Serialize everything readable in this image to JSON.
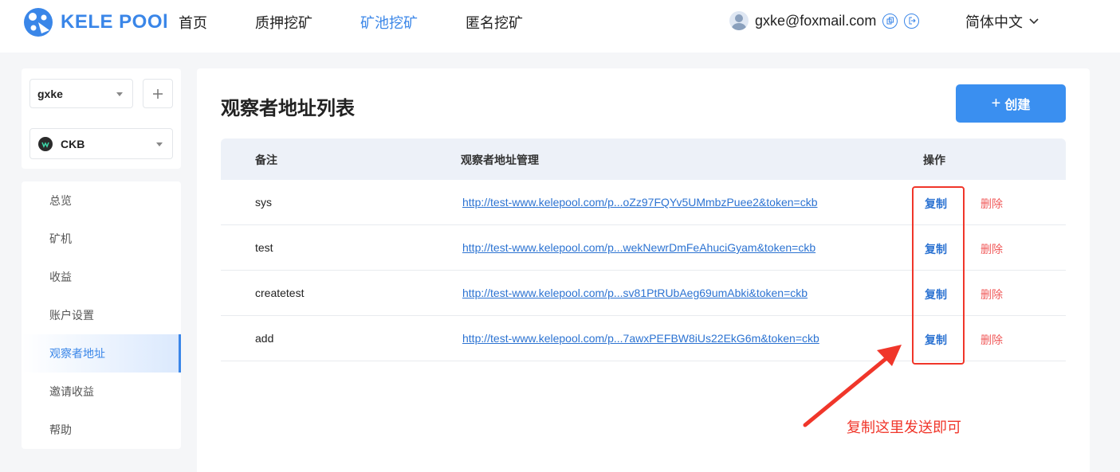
{
  "brand": {
    "name": "KELE POOl"
  },
  "nav": {
    "items": [
      {
        "label": "首页"
      },
      {
        "label": "质押挖矿"
      },
      {
        "label": "矿池挖矿"
      },
      {
        "label": "匿名挖矿"
      }
    ]
  },
  "user": {
    "email": "gxke@foxmail.com"
  },
  "language": {
    "label": "简体中文"
  },
  "sidebar": {
    "account_select": {
      "value": "gxke"
    },
    "coin_select": {
      "value": "CKB"
    },
    "menu": [
      {
        "label": "总览"
      },
      {
        "label": "矿机"
      },
      {
        "label": "收益"
      },
      {
        "label": "账户设置"
      },
      {
        "label": "观察者地址"
      },
      {
        "label": "邀请收益"
      },
      {
        "label": "帮助"
      }
    ]
  },
  "main": {
    "title": "观察者地址列表",
    "create_label": "创建",
    "table": {
      "headers": {
        "remark": "备注",
        "address": "观察者地址管理",
        "actions": "操作"
      },
      "rows": [
        {
          "remark": "sys",
          "link": "http://test-www.kelepool.com/p...oZz97FQYv5UMmbzPuee2&token=ckb",
          "copy": "复制",
          "delete": "删除"
        },
        {
          "remark": "test",
          "link": "http://test-www.kelepool.com/p...wekNewrDmFeAhuciGyam&token=ckb",
          "copy": "复制",
          "delete": "删除"
        },
        {
          "remark": "createtest",
          "link": "http://test-www.kelepool.com/p...sv81PtRUbAeg69umAbki&token=ckb",
          "copy": "复制",
          "delete": "删除"
        },
        {
          "remark": "add",
          "link": "http://test-www.kelepool.com/p...7awxPEFBW8iUs22EkG6m&token=ckb",
          "copy": "复制",
          "delete": "删除"
        }
      ]
    }
  },
  "annotation": {
    "text": "复制这里发送即可",
    "color": "#f0362a"
  },
  "colors": {
    "accent": "#3a86e8",
    "danger": "#f05a5a"
  }
}
